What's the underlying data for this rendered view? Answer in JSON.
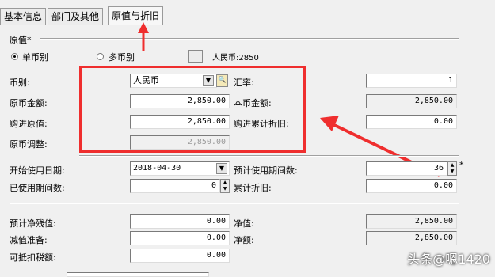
{
  "tabs": [
    "基本信息",
    "部门及其他",
    "原值与折旧"
  ],
  "section_title": "原值*",
  "currency_mode": {
    "single": "单币别",
    "multi": "多币别",
    "rmb_note": "人民币:2850"
  },
  "labels": {
    "currency": "币别:",
    "exchange_rate": "汇率:",
    "orig_amount": "原币金额:",
    "local_amount": "本币金额:",
    "purchase_value": "购进原值:",
    "purchase_depr": "购进累计折旧:",
    "orig_adjust": "原币调整:",
    "start_date": "开始使用日期:",
    "est_periods": "预计使用期间数:",
    "used_periods": "已使用期间数:",
    "acc_depr": "累计折旧:",
    "residual": "预计净残值:",
    "net_value": "净值:",
    "impairment": "减值准备:",
    "net_amount": "净额:",
    "deductible_tax": "可抵扣税额:",
    "est_periods_required": "*"
  },
  "values": {
    "currency": "人民币",
    "exchange_rate": "1",
    "orig_amount": "2,850.00",
    "local_amount": "2,850.00",
    "purchase_value": "2,850.00",
    "purchase_depr": "0.00",
    "orig_adjust": "2,850.00",
    "start_date": "2018-04-30",
    "est_periods": "36",
    "used_periods": "0",
    "acc_depr": "0.00",
    "residual": "0.00",
    "net_value": "2,850.00",
    "impairment": "0.00",
    "net_amount": "2,850.00",
    "deductible_tax": "0.00"
  },
  "watermark": "头条@嗯1420",
  "colors": {
    "annotation": "#ef2e2e"
  }
}
